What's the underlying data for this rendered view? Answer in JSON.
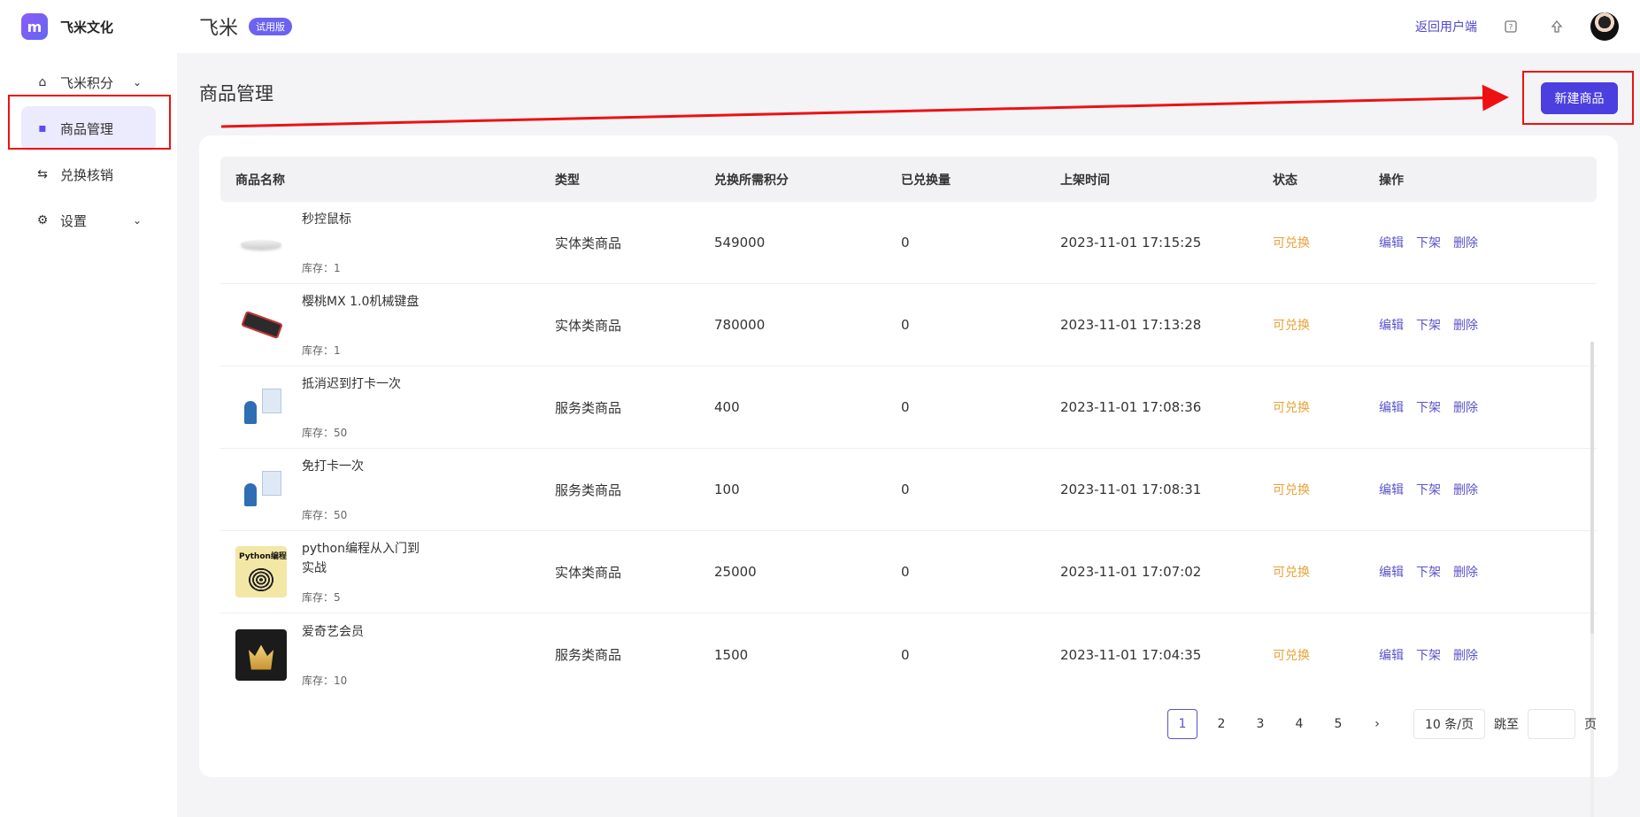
{
  "brand": {
    "logo_text": "m",
    "name": "飞米文化"
  },
  "sidebar": {
    "items": [
      {
        "label": "飞米积分",
        "icon": "home-icon",
        "has_chevron": true
      },
      {
        "label": "商品管理",
        "icon": "bag-icon",
        "active": true
      },
      {
        "label": "兑换核销",
        "icon": "swap-icon"
      },
      {
        "label": "设置",
        "icon": "gear-icon",
        "has_chevron": true
      }
    ]
  },
  "header": {
    "title": "飞米",
    "badge": "试用版",
    "back_link": "返回用户端"
  },
  "main": {
    "page_title": "商品管理",
    "new_button": "新建商品"
  },
  "table": {
    "columns": [
      "商品名称",
      "类型",
      "兑换所需积分",
      "已兑换量",
      "上架时间",
      "状态",
      "操作"
    ],
    "stock_prefix": "库存：",
    "rows": [
      {
        "name": "秒控鼠标",
        "stock": "库存：1",
        "type": "实体类商品",
        "points": "549000",
        "sold": "0",
        "time": "2023-11-01 17:15:25",
        "status": "可兑换",
        "ops": [
          "编辑",
          "下架",
          "删除"
        ],
        "thumb": "mouse"
      },
      {
        "name": "樱桃MX 1.0机械键盘",
        "stock": "库存：1",
        "type": "实体类商品",
        "points": "780000",
        "sold": "0",
        "time": "2023-11-01 17:13:28",
        "status": "可兑换",
        "ops": [
          "编辑",
          "下架",
          "删除"
        ],
        "thumb": "keyboard"
      },
      {
        "name": "抵消迟到打卡一次",
        "stock": "库存：50",
        "type": "服务类商品",
        "points": "400",
        "sold": "0",
        "time": "2023-11-01 17:08:36",
        "status": "可兑换",
        "ops": [
          "编辑",
          "下架",
          "删除"
        ],
        "thumb": "desk"
      },
      {
        "name": "免打卡一次",
        "stock": "库存：50",
        "type": "服务类商品",
        "points": "100",
        "sold": "0",
        "time": "2023-11-01 17:08:31",
        "status": "可兑换",
        "ops": [
          "编辑",
          "下架",
          "删除"
        ],
        "thumb": "desk"
      },
      {
        "name": "python编程从入门到实战",
        "stock": "库存：5",
        "type": "实体类商品",
        "points": "25000",
        "sold": "0",
        "time": "2023-11-01 17:07:02",
        "status": "可兑换",
        "ops": [
          "编辑",
          "下架",
          "删除"
        ],
        "thumb": "book"
      },
      {
        "name": "爱奇艺会员",
        "stock": "库存：10",
        "type": "服务类商品",
        "points": "1500",
        "sold": "0",
        "time": "2023-11-01 17:04:35",
        "status": "可兑换",
        "ops": [
          "编辑",
          "下架",
          "删除"
        ],
        "thumb": "vip"
      }
    ]
  },
  "pagination": {
    "pages": [
      "1",
      "2",
      "3",
      "4",
      "5"
    ],
    "current": "1",
    "next": "›",
    "page_size": "10 条/页",
    "jump_label": "跳至",
    "page_unit": "页"
  },
  "colors": {
    "accent": "#4b3fe0",
    "status_available": "#e8a33a",
    "link": "#5b53c9",
    "annotation_red": "#ee1111"
  }
}
